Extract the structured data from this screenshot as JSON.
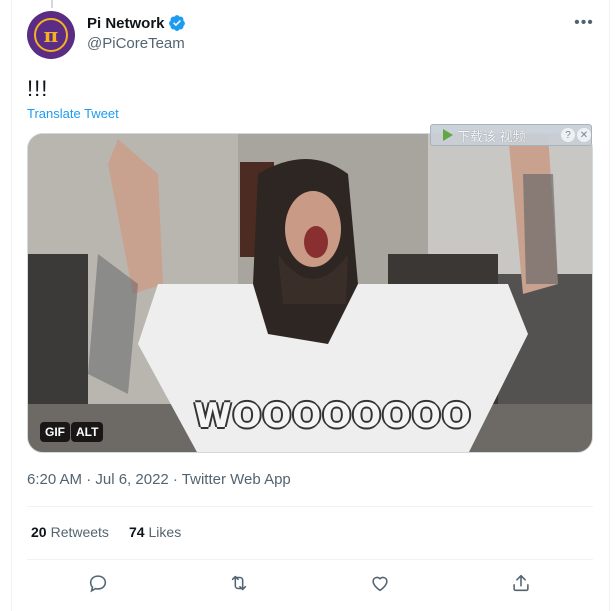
{
  "author": {
    "display_name": "Pi Network",
    "handle": "@PiCoreTeam",
    "verified": true,
    "avatar_glyph": "π",
    "avatar_colors": {
      "background": "#5b2c83",
      "ring": "#f4b223"
    }
  },
  "tweet": {
    "text": "!!!",
    "translate_label": "Translate Tweet"
  },
  "media": {
    "caption": "WOOOOOOOO",
    "gif_label": "GIF",
    "alt_label": "ALT",
    "download_overlay": {
      "label": "下载该 视频",
      "help": "?",
      "close": "✕"
    }
  },
  "meta": {
    "timestamp": "6:20 AM · Jul 6, 2022 · Twitter Web App"
  },
  "stats": {
    "retweets_count": "20",
    "retweets_label": "Retweets",
    "likes_count": "74",
    "likes_label": "Likes"
  },
  "actions": {
    "more_glyph": "•••"
  },
  "colors": {
    "accent": "#1d9bf0",
    "text_primary": "#0f1419",
    "text_secondary": "#536471",
    "divider": "#eff3f4"
  },
  "icons": [
    "verified-badge-icon",
    "more-icon",
    "reply-icon",
    "retweet-icon",
    "like-icon",
    "share-icon",
    "play-icon"
  ]
}
